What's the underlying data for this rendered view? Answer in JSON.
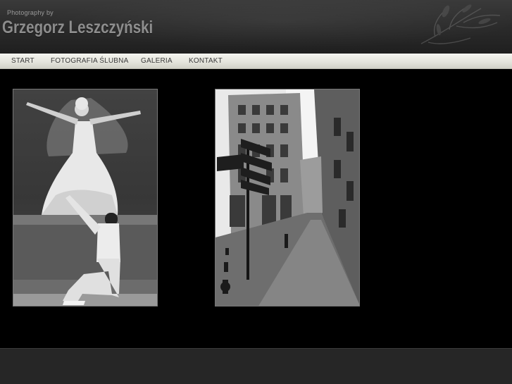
{
  "header": {
    "tagline": "Photography by",
    "site_title": "Grzegorz Leszczyński"
  },
  "nav": {
    "items": [
      {
        "label": "START"
      },
      {
        "label": "FOTOGRAFIA ŚLUBNA"
      },
      {
        "label": "GALERIA"
      },
      {
        "label": "KONTAKT"
      }
    ]
  },
  "gallery": {
    "photos": [
      {
        "subject": "wedding-couple"
      },
      {
        "subject": "street-scene"
      }
    ]
  },
  "colors": {
    "background": "#000000",
    "nav_text": "#3a3a3a",
    "title_text": "#8c8c8c"
  }
}
